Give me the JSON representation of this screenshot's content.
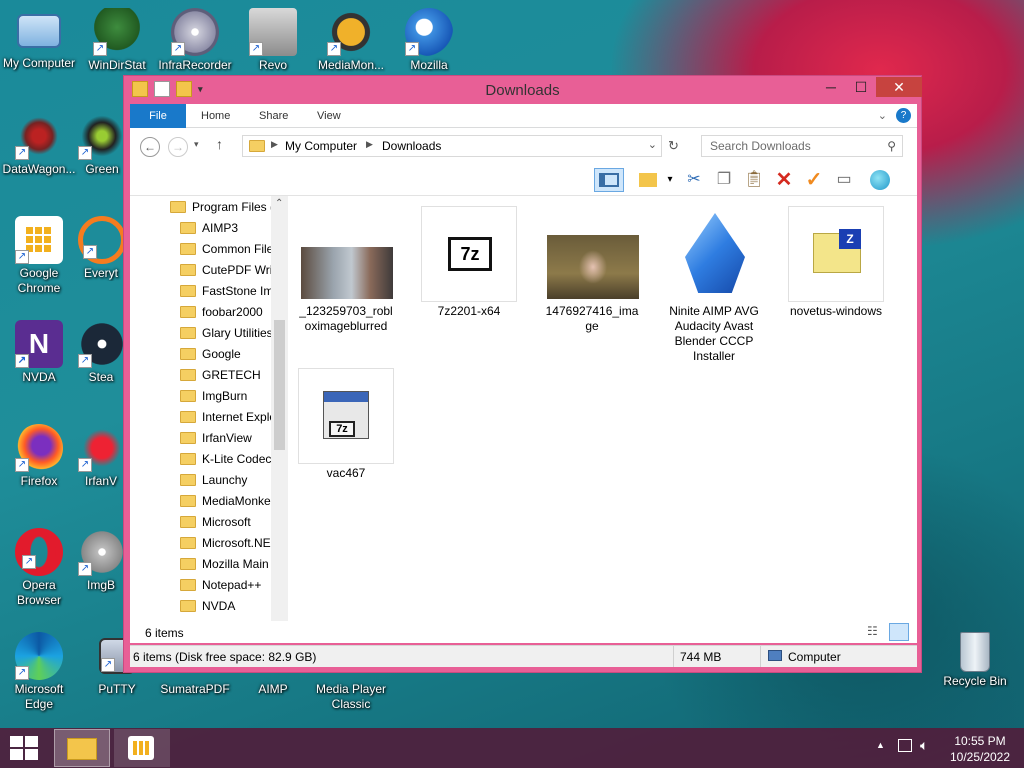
{
  "desktop": {
    "icons": [
      {
        "label": "My Computer",
        "icon": "computer-icon"
      },
      {
        "label": "WinDirStat",
        "icon": "tree-icon"
      },
      {
        "label": "InfraRecorder",
        "icon": "disc-icon"
      },
      {
        "label": "Revo",
        "icon": "uninstaller-icon"
      },
      {
        "label": "MediaMon...",
        "icon": "mediamonkey-icon"
      },
      {
        "label": "Mozilla",
        "icon": "thunderbird-icon"
      },
      {
        "label": "DataWagon...",
        "icon": "datawagon-icon"
      },
      {
        "label": "Green",
        "icon": "green-icon"
      },
      {
        "label": "Google Chrome",
        "icon": "app-grid-icon"
      },
      {
        "label": "Everyt",
        "icon": "search-icon"
      },
      {
        "label": "NVDA",
        "icon": "nvda-icon"
      },
      {
        "label": "Stea",
        "icon": "steam-icon"
      },
      {
        "label": "Firefox",
        "icon": "firefox-icon"
      },
      {
        "label": "IrfanV",
        "icon": "irfanview-icon"
      },
      {
        "label": "Opera Browser",
        "icon": "opera-icon"
      },
      {
        "label": "ImgB",
        "icon": "imgburn-icon"
      },
      {
        "label": "Microsoft Edge",
        "icon": "edge-icon"
      },
      {
        "label": "PuTTY",
        "icon": "putty-icon"
      },
      {
        "label": "SumatraPDF",
        "icon": "pdf-icon"
      },
      {
        "label": "AIMP",
        "icon": "aimp-icon"
      },
      {
        "label": "Media Player Classic",
        "icon": "mpc-icon"
      },
      {
        "label": "Recycle Bin",
        "icon": "recycle-bin-icon"
      }
    ]
  },
  "window": {
    "title": "Downloads",
    "min": "─",
    "max": "☐",
    "close": "✕",
    "ribbon_tabs": [
      "File",
      "Home",
      "Share",
      "View"
    ],
    "address": {
      "root": "My Computer",
      "current": "Downloads"
    },
    "search_placeholder": "Search Downloads",
    "tree": [
      "Program Files (",
      "AIMP3",
      "Common File",
      "CutePDF Writ",
      "FastStone Ima",
      "foobar2000",
      "Glary Utilities",
      "Google",
      "GRETECH",
      "ImgBurn",
      "Internet Explo",
      "IrfanView",
      "K-Lite Codec",
      "Launchy",
      "MediaMonke",
      "Microsoft",
      "Microsoft.NE",
      "Mozilla Main",
      "Notepad++",
      "NVDA"
    ],
    "files": [
      {
        "name": "_123259703_robloximageblurred",
        "type": "image-thumb"
      },
      {
        "name": "7z2201-x64",
        "type": "7z-installer"
      },
      {
        "name": "1476927416_image",
        "type": "image-thumb"
      },
      {
        "name": "Ninite AIMP AVG Audacity Avast Blender CCCP Installer",
        "type": "ninite"
      },
      {
        "name": "novetus-windows",
        "type": "archive"
      },
      {
        "name": "vac467",
        "type": "setup"
      }
    ],
    "item_count": "6 items",
    "status_left": "6 items (Disk free space: 82.9 GB)",
    "status_size": "744 MB",
    "status_location": "Computer"
  },
  "taskbar": {
    "time": "10:55 PM",
    "date": "10/25/2022"
  }
}
